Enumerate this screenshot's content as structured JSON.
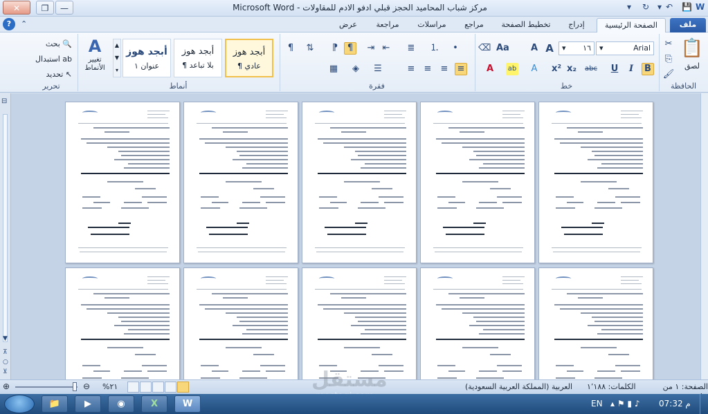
{
  "titlebar": {
    "title": "مركز شباب المحاميد الحجز قبلي ادفو الادم للمقاولات - Microsoft Word",
    "minimize": "—",
    "restore": "❐",
    "close": "✕",
    "help_glyph": "?"
  },
  "tabs": [
    "ملف",
    "الصفحة الرئيسية",
    "إدراج",
    "تخطيط الصفحة",
    "مراجع",
    "مراسلات",
    "مراجعة",
    "عرض"
  ],
  "ribbon": {
    "clipboard": {
      "label": "الحافظة",
      "paste": "لصق"
    },
    "font": {
      "label": "خط",
      "font_name": "Arial",
      "font_size": "١٦",
      "bold": "B",
      "italic": "I",
      "underline": "U",
      "strike": "abc",
      "sub": "x₂",
      "sup": "x²"
    },
    "paragraph": {
      "label": "فقرة"
    },
    "styles": {
      "label": "أنماط",
      "items": [
        {
          "sample": "أبجد هوز",
          "name": "¶ عادي"
        },
        {
          "sample": "أبجد هوز",
          "name": "¶ بلا تباعد"
        },
        {
          "sample": "أبجد هوز",
          "name": "عنوان ١"
        }
      ],
      "change_styles": "تغيير الأنماط"
    },
    "editing": {
      "label": "تحرير",
      "find": "بحث",
      "replace": "استبدال",
      "select": "تحديد"
    }
  },
  "status": {
    "page": "الصفحة: ١ من ١٠",
    "words": "الكلمات: ١٬١٨٨",
    "language": "العربية (المملكة العربية السعودية)",
    "zoom": "٢١%"
  },
  "taskbar": {
    "lang": "EN",
    "time": "07:32 م"
  },
  "watermark": {
    "brand": "مستقل",
    "site": "mostaqi.com"
  }
}
